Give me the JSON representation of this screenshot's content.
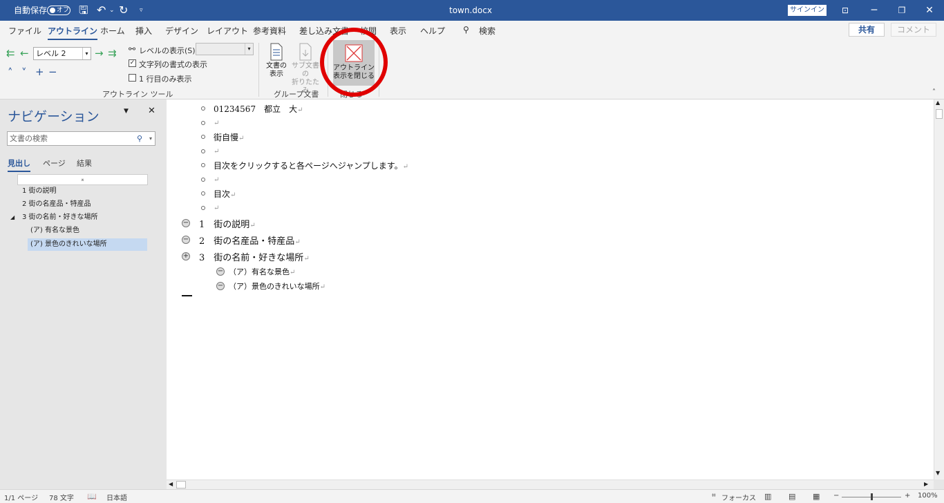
{
  "titlebar": {
    "autosave_label": "自動保存",
    "autosave_state": "オフ",
    "doc_title": "town.docx",
    "signin": "サインイン",
    "icons": [
      "save-icon",
      "undo-icon",
      "redo-icon",
      "customize-icon"
    ]
  },
  "tabs": [
    {
      "label": "ファイル"
    },
    {
      "label": "アウトライン"
    },
    {
      "label": "ホーム"
    },
    {
      "label": "挿入"
    },
    {
      "label": "デザイン"
    },
    {
      "label": "レイアウト"
    },
    {
      "label": "参考資料"
    },
    {
      "label": "差し込み文書"
    },
    {
      "label": "校閲"
    },
    {
      "label": "表示"
    },
    {
      "label": "ヘルプ"
    }
  ],
  "search_label": "検索",
  "share_label": "共有",
  "comment_label": "コメント",
  "ribbon": {
    "level_value": "レベル 2",
    "show_level_label": "レベルの表示(S):",
    "show_text_format_label": "文字列の書式の表示",
    "first_line_only_label": "1 行目のみ表示",
    "outline_tools_group": "アウトライン ツール",
    "show_document_l1": "文書の",
    "show_document_l2": "表示",
    "collapse_sub_l1": "サブ文書の",
    "collapse_sub_l2": "折りたたみ",
    "master_doc_group": "グループ文書",
    "close_outline_l1": "アウトライン",
    "close_outline_l2": "表示を閉じる",
    "close_group": "閉じる"
  },
  "nav": {
    "title": "ナビゲーション",
    "search_placeholder": "文書の検索",
    "tabs": [
      "見出し",
      "ページ",
      "結果"
    ],
    "headings": [
      "1 街の説明",
      "2 街の名産品・特産品",
      "3 街の名前・好きな場所",
      "(ア) 有名な景色",
      "(ア) 景色のきれいな場所"
    ]
  },
  "document": {
    "body_lines": [
      "01234567　都立　大",
      "",
      "街自慢",
      "",
      "目次をクリックすると各ページへジャンプします。",
      "",
      "目次",
      ""
    ],
    "headings": [
      {
        "num": "1",
        "text": "街の説明"
      },
      {
        "num": "2",
        "text": "街の名産品・特産品"
      },
      {
        "num": "3",
        "text": "街の名前・好きな場所"
      }
    ],
    "subheadings": [
      "（ア）有名な景色",
      "（ア）景色のきれいな場所"
    ],
    "para_mark": "↵"
  },
  "status": {
    "page": "1/1 ページ",
    "words": "78 文字",
    "language": "日本語",
    "focus": "フォーカス",
    "zoom": "100%"
  }
}
